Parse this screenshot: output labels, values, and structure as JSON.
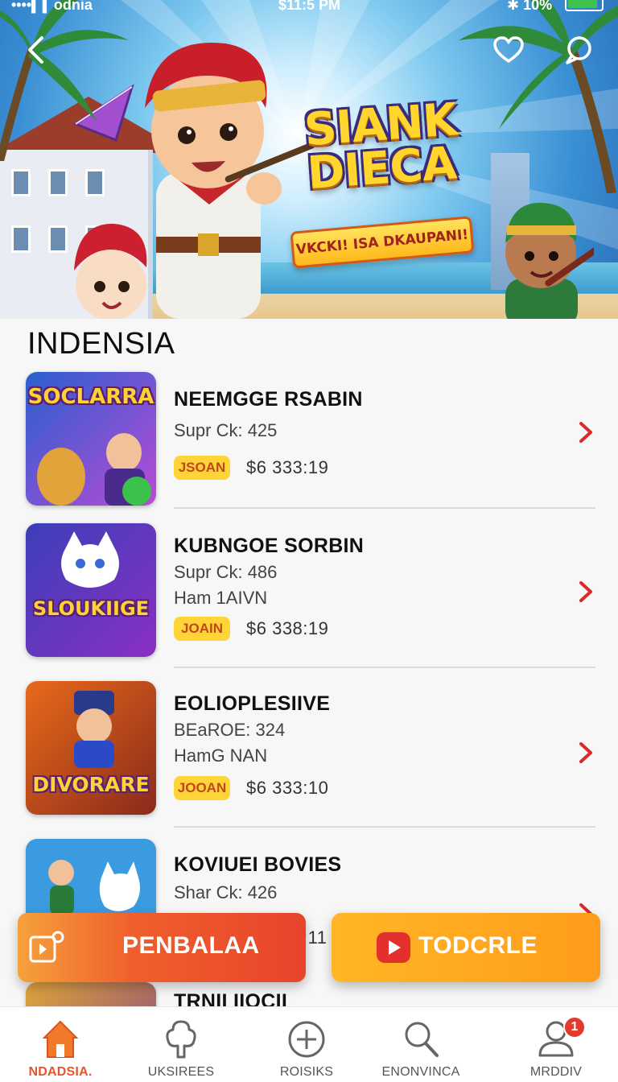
{
  "status_bar": {
    "carrier": "••••▍▍odnia",
    "time": "$11:5 PM",
    "battery": "✱ 10%"
  },
  "hero": {
    "title": "SIANK\nDIECA",
    "ribbon": "VKCKI! ISA DKAUPANI!"
  },
  "section": {
    "title": "INDENSIA"
  },
  "items": [
    {
      "name": "NEEMGGE RSABIN",
      "sub1": "Supr Ck: 425",
      "sub2": "",
      "badge": "JSOAN",
      "price": "$6  333:19",
      "thumb_title": "SOCLARRA",
      "thumb_colors": [
        "#2a5fcf",
        "#b84bd6"
      ]
    },
    {
      "name": "KUBNGOE SORBIN",
      "sub1": "Supr Ck: 486",
      "sub2": "Ham 1AIVN",
      "badge": "JOAIN",
      "price": "$6  338:19",
      "thumb_title": "SLOUKIIGE",
      "thumb_colors": [
        "#3b3fb8",
        "#8a2fc4"
      ]
    },
    {
      "name": "EOLIOPLESIIVE",
      "sub1": "BEaROE: 324",
      "sub2": "HamG NAN",
      "badge": "JOOAN",
      "price": "$6  333:10",
      "thumb_title": "DIVORARE",
      "thumb_colors": [
        "#e86a1a",
        "#8a2a1b"
      ]
    },
    {
      "name": "KOVIUEI BOVIES",
      "sub1": "Shar Ck: 426",
      "sub2": "",
      "badge": "",
      "price": "",
      "thumb_title": "",
      "thumb_colors": [
        "#3a9be0",
        "#6fc23a"
      ]
    },
    {
      "name": "TRNII IIOCII",
      "sub1": "",
      "sub2": "",
      "badge": "",
      "price": "",
      "thumb_title": "",
      "thumb_colors": [
        "#e0a53a",
        "#7a3a8a"
      ]
    }
  ],
  "partial_price": ":11",
  "actions": {
    "left_label": "PENBALAA",
    "right_label": "TODCRLE"
  },
  "nav": [
    {
      "label": "NDADSIA.",
      "icon": "home-icon",
      "active": true
    },
    {
      "label": "UKSIREES",
      "icon": "tree-icon",
      "active": false
    },
    {
      "label": "ROISIKS",
      "icon": "plus-circle-icon",
      "active": false
    },
    {
      "label": "ENONVINCA",
      "icon": "search-icon",
      "active": false
    },
    {
      "label": "MRDDIV",
      "icon": "profile-icon",
      "active": false
    }
  ],
  "notification_count": "1",
  "colors": {
    "accent": "#e8542a",
    "badge": "#ffd438",
    "chevron": "#d92b2b"
  }
}
